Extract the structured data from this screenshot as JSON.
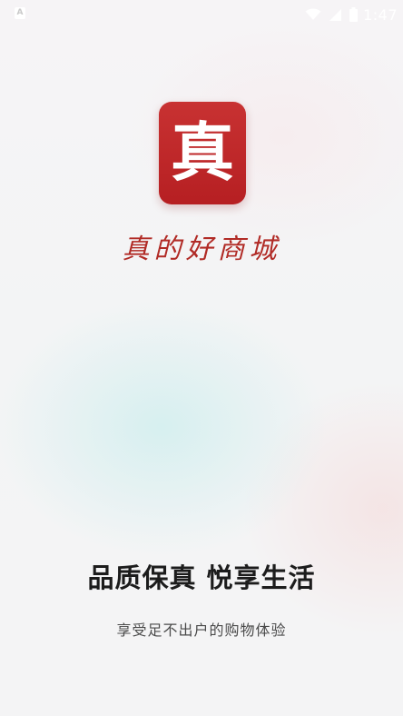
{
  "status_bar": {
    "notification_icon": "A",
    "time": "1:47",
    "icons": [
      "wifi-icon",
      "signal-icon",
      "battery-icon"
    ]
  },
  "logo": {
    "glyph": "真",
    "color": "#bd2427"
  },
  "slogan": "真的好商城",
  "tagline": "品质保真 悦享生活",
  "subtagline": "享受足不出户的购物体验"
}
